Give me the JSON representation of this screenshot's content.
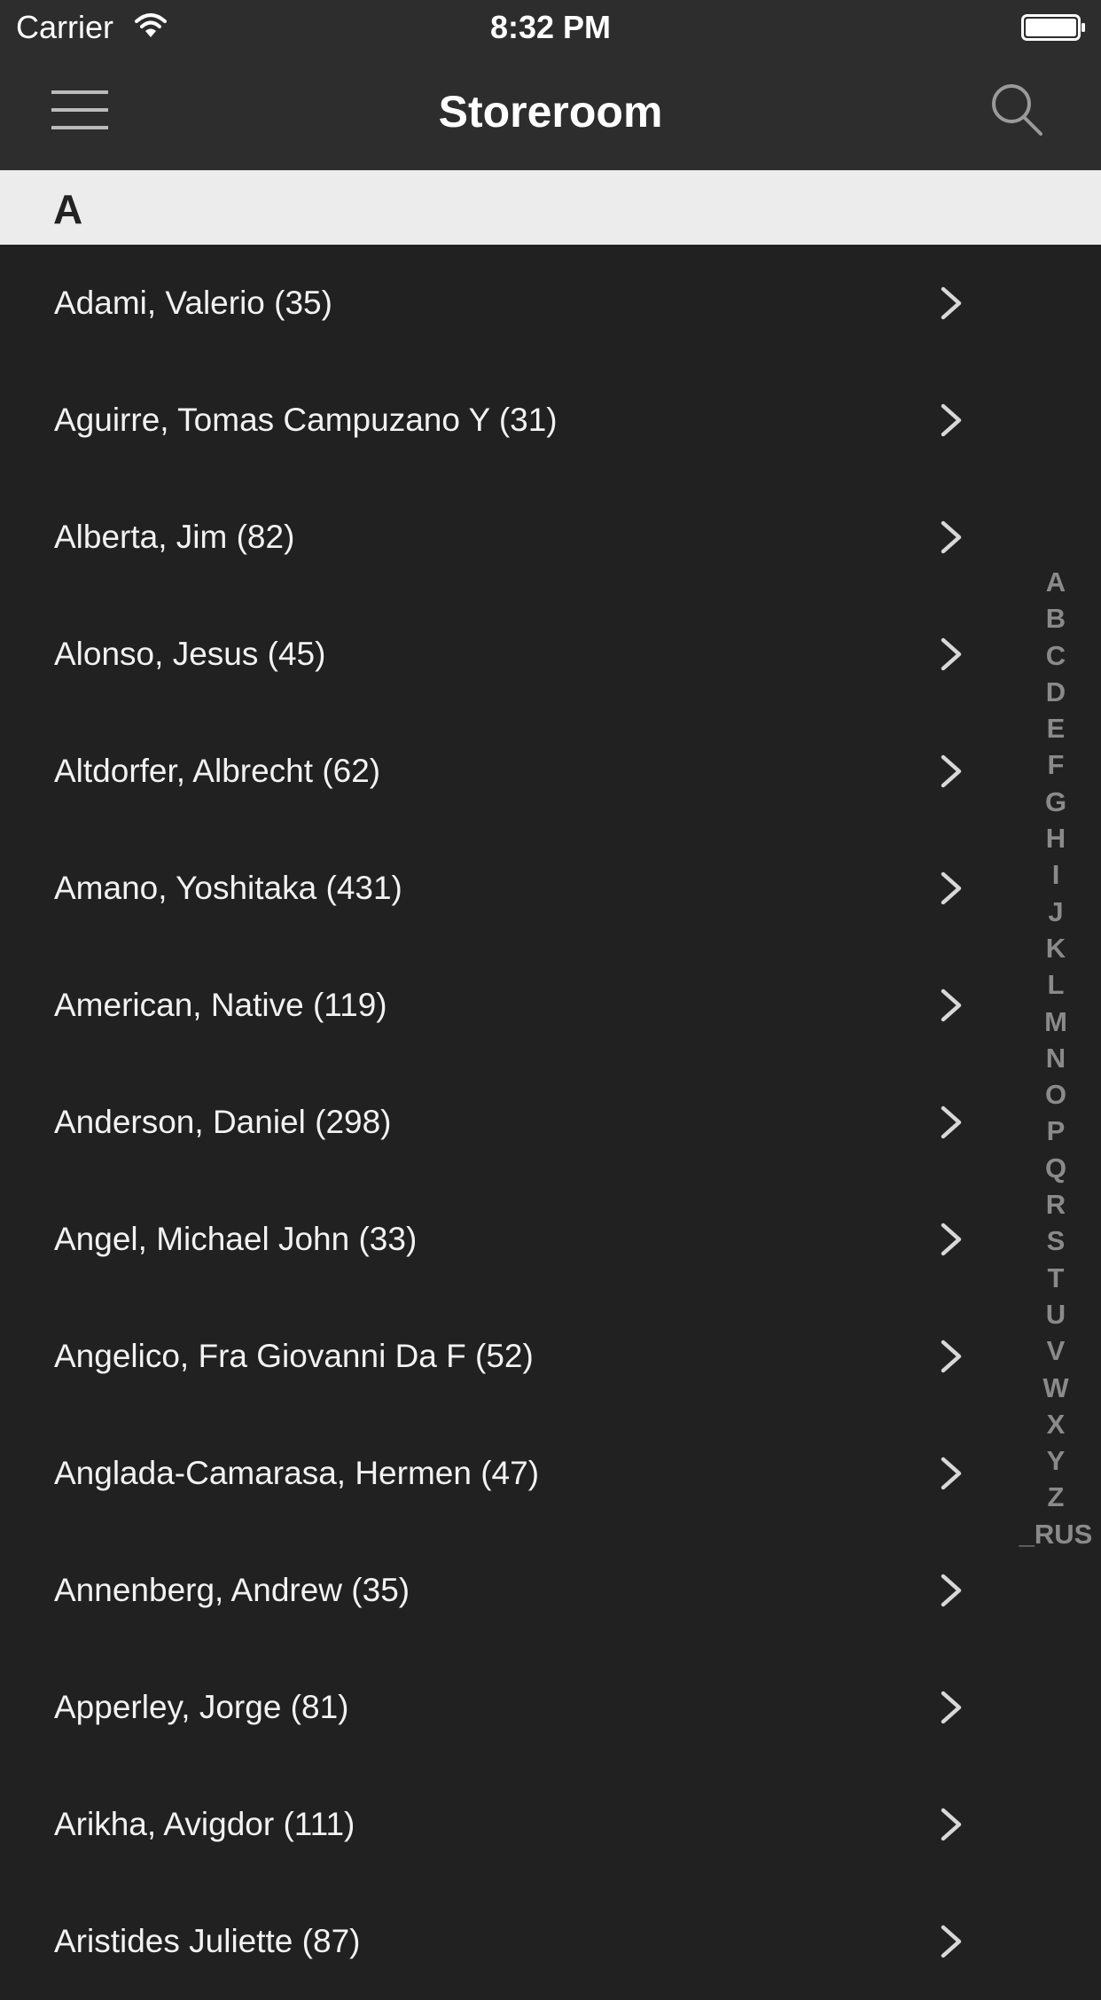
{
  "status_bar": {
    "carrier": "Carrier",
    "time": "8:32 PM",
    "icons": [
      "wifi-icon",
      "battery-icon"
    ]
  },
  "nav_bar": {
    "title": "Storeroom",
    "left_icon": "menu-icon",
    "right_icon": "search-icon"
  },
  "section": {
    "letter": "A"
  },
  "list": {
    "items": [
      "Adami, Valerio (35)",
      "Aguirre, Tomas Campuzano Y (31)",
      "Alberta, Jim (82)",
      "Alonso, Jesus (45)",
      "Altdorfer, Albrecht (62)",
      "Amano, Yoshitaka (431)",
      "American, Native (119)",
      "Anderson, Daniel (298)",
      "Angel, Michael John (33)",
      "Angelico, Fra Giovanni Da F (52)",
      "Anglada-Camarasa, Hermen (47)",
      "Annenberg, Andrew (35)",
      "Apperley, Jorge (81)",
      "Arikha, Avigdor (111)",
      "Aristides Juliette (87)"
    ],
    "row_icon": "chevron-right-icon"
  },
  "index": {
    "letters": [
      "A",
      "B",
      "C",
      "D",
      "E",
      "F",
      "G",
      "H",
      "I",
      "J",
      "K",
      "L",
      "M",
      "N",
      "O",
      "P",
      "Q",
      "R",
      "S",
      "T",
      "U",
      "V",
      "W",
      "X",
      "Y",
      "Z",
      "_RUS"
    ]
  },
  "colors": {
    "background": "#212121",
    "bar": "#2d2d2d",
    "section_header": "#ececec",
    "index_text": "#8a8a8a"
  }
}
